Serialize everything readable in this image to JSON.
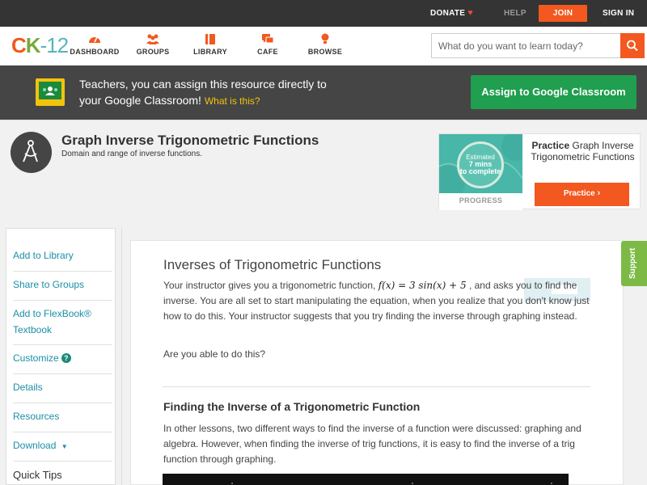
{
  "topbar": {
    "donate": "DONATE",
    "help": "HELP",
    "join": "JOIN",
    "signin": "SIGN IN"
  },
  "nav": {
    "logo": {
      "c": "C",
      "k": "K",
      "num": "-12"
    },
    "items": [
      {
        "label": "DASHBOARD",
        "icon": "dashboard-icon"
      },
      {
        "label": "GROUPS",
        "icon": "groups-icon"
      },
      {
        "label": "LIBRARY",
        "icon": "library-icon"
      },
      {
        "label": "CAFE",
        "icon": "cafe-icon"
      },
      {
        "label": "BROWSE",
        "icon": "browse-icon"
      }
    ],
    "search_placeholder": "What do you want to learn today?"
  },
  "banner": {
    "text_line1": "Teachers, you can assign this resource directly to",
    "text_line2": "your Google Classroom!",
    "what_link": "What is this?",
    "assign_button": "Assign to Google Classroom"
  },
  "header": {
    "title": "Graph Inverse Trigonometric Functions",
    "subtitle": "Domain and range of inverse functions."
  },
  "practice": {
    "estimated": "Estimated",
    "mins": "7 mins",
    "to_complete": "to complete",
    "progress_label": "PROGRESS",
    "title_bold": "Practice",
    "title_rest": "Graph Inverse Trigonometric Functions",
    "button": "Practice"
  },
  "sidebar": {
    "items": [
      "Add to Library",
      "Share to Groups",
      "Add to FlexBook® Textbook",
      "Customize",
      "Details",
      "Resources",
      "Download",
      "Quick Tips"
    ]
  },
  "content": {
    "title": "Inverses of Trigonometric Functions",
    "p1_before": "Your instructor gives you a trigonometric function,",
    "p1_math": "f(x) = 3 sin(x) + 5",
    "p1_after": ", and asks you to find the inverse. You are all set to start manipulating the equation, when you realize that you don't know just how to do this. Your instructor suggests that you try finding the inverse through graphing instead.",
    "p2": "Are you able to do this?",
    "h2": "Finding the Inverse of a Trigonometric Function",
    "p3": "In other lessons, two different ways to find the inverse of a function were discussed: graphing and algebra. However, when finding the inverse of trig functions, it is easy to find the inverse of a trig function through graphing."
  },
  "support": "Support",
  "colors": {
    "brand_orange": "#f2581f",
    "brand_green": "#7aa93c",
    "brand_teal": "#56b5b9",
    "google_green": "#1f9f4f",
    "link_blue": "#1a8ea7"
  }
}
